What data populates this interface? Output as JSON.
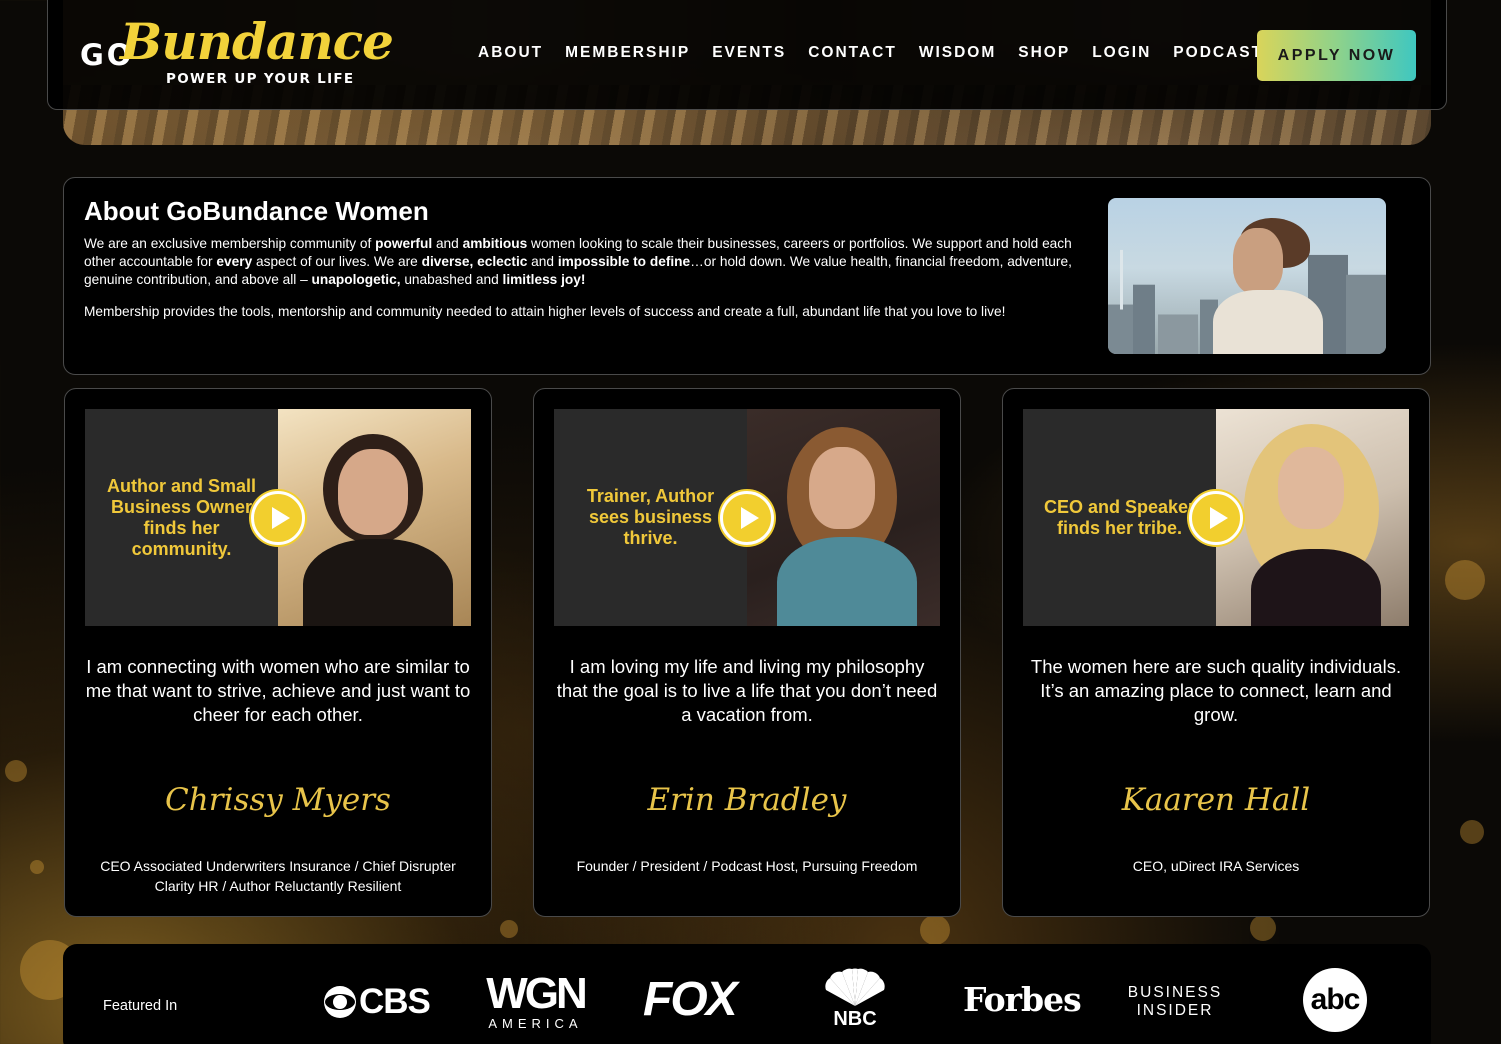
{
  "header": {
    "logo": {
      "go": "GO",
      "script": "Bundance",
      "tagline": "POWER UP YOUR LIFE"
    },
    "nav": [
      {
        "label": "ABOUT"
      },
      {
        "label": "MEMBERSHIP"
      },
      {
        "label": "EVENTS"
      },
      {
        "label": "CONTACT"
      },
      {
        "label": "WISDOM"
      },
      {
        "label": "SHOP"
      },
      {
        "label": "LOGIN"
      },
      {
        "label": "PODCAST"
      }
    ],
    "cta_label": "APPLY NOW"
  },
  "about": {
    "title": "About GoBundance Women",
    "p1": [
      {
        "t": "We are an exclusive membership community of ",
        "b": false
      },
      {
        "t": "powerful",
        "b": true
      },
      {
        "t": " and ",
        "b": false
      },
      {
        "t": "ambitious",
        "b": true
      },
      {
        "t": " women looking to scale their businesses, careers or portfolios. We support and hold each other accountable for ",
        "b": false
      },
      {
        "t": "every",
        "b": true
      },
      {
        "t": " aspect of our lives. We are ",
        "b": false
      },
      {
        "t": "diverse, eclectic",
        "b": true
      },
      {
        "t": " and ",
        "b": false
      },
      {
        "t": "impossible to define",
        "b": true
      },
      {
        "t": "…or hold down. We value health, financial freedom, adventure, genuine contribution, and above all – ",
        "b": false
      },
      {
        "t": "unapologetic,",
        "b": true
      },
      {
        "t": " unabashed and ",
        "b": false
      },
      {
        "t": "limitless joy!",
        "b": true
      }
    ],
    "p2": "Membership provides the tools, mentorship and community needed to attain higher levels of success and create a full, abundant life that you love to live!"
  },
  "testimonials": [
    {
      "video_caption": "Author and Small Business Owner finds her community.",
      "quote": "I am connecting with women who are similar to me that want to strive, achieve and just want to cheer for each other.",
      "name": "Chrissy Myers",
      "role": "CEO Associated Underwriters Insurance / Chief Disrupter Clarity HR / Author Reluctantly Resilient"
    },
    {
      "video_caption": "Trainer, Author sees business thrive.",
      "quote": "I am loving my life and living my philosophy that the goal is to live a life that you don’t need a vacation from.",
      "name": "Erin Bradley",
      "role": "Founder / President / Podcast Host, Pursuing Freedom"
    },
    {
      "video_caption": "CEO and Speaker finds her tribe.",
      "quote": "The women here are such quality individuals. It’s an amazing place to connect, learn and grow.",
      "name": "Kaaren Hall",
      "role": "CEO, uDirect IRA Services"
    }
  ],
  "featured": {
    "label": "Featured In",
    "logos": [
      {
        "icon": "cbs-logo",
        "text": "CBS"
      },
      {
        "icon": "wgn-america-logo",
        "text": "WGN",
        "sub": "AMERICA"
      },
      {
        "icon": "fox-logo",
        "text": "FOX"
      },
      {
        "icon": "nbc-logo",
        "text": "NBC"
      },
      {
        "icon": "forbes-logo",
        "text": "Forbes"
      },
      {
        "icon": "business-insider-logo",
        "text": "BUSINESS",
        "sub": "INSIDER"
      },
      {
        "icon": "abc-logo",
        "text": "abc"
      }
    ]
  },
  "colors": {
    "accent_gold": "#f2cf2e",
    "cta_gradient_start": "#d9d45a",
    "cta_gradient_end": "#3fc7c0",
    "signature": "#e8c44a"
  }
}
